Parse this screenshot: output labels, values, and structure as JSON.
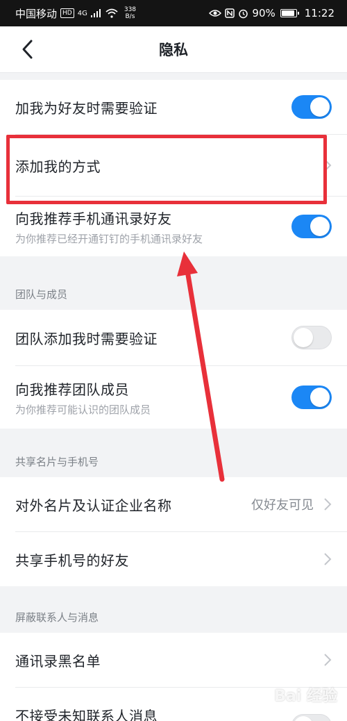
{
  "status_bar": {
    "carrier": "中国移动",
    "hd_badge": "HD",
    "network": "4G",
    "speed_value": "338",
    "speed_unit": "B/s",
    "battery": "90%",
    "battery_level": 0.9,
    "time": "11:22",
    "icons": [
      "eye-icon",
      "nfc-icon",
      "alarm-icon",
      "battery-icon"
    ]
  },
  "navbar": {
    "title": "隐私",
    "back_icon": "chevron-left-icon"
  },
  "section1": {
    "rows": [
      {
        "title": "加我为好友时需要验证",
        "toggle": true
      },
      {
        "title": "添加我的方式"
      },
      {
        "title": "向我推荐手机通讯录好友",
        "subtitle": "为你推荐已经开通钉钉的手机通讯录好友",
        "toggle": true
      }
    ]
  },
  "team": {
    "header": "团队与成员",
    "rows": [
      {
        "title": "团队添加我时需要验证",
        "toggle": false
      },
      {
        "title": "向我推荐团队成员",
        "subtitle": "为你推荐可能认识的团队成员",
        "toggle": true
      }
    ]
  },
  "share": {
    "header": "共享名片与手机号",
    "rows": [
      {
        "title": "对外名片及认证企业名称",
        "value": "仅好友可见"
      },
      {
        "title": "共享手机号的好友"
      }
    ]
  },
  "block": {
    "header": "屏蔽联系人与消息",
    "rows": [
      {
        "title": "通讯录黑名单"
      },
      {
        "title": "不接受未知联系人消息"
      }
    ]
  },
  "watermark": "Bai 经验",
  "colors": {
    "accent": "#1b87f5",
    "annotation": "#e8303a"
  }
}
